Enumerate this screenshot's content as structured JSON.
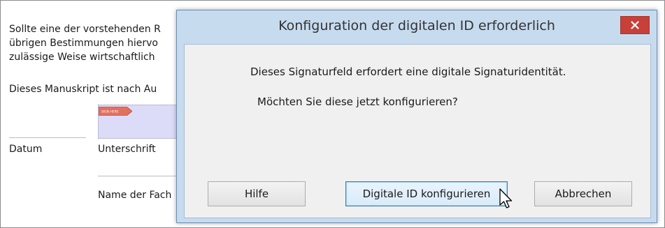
{
  "document": {
    "lines": [
      "Sollte eine der vorstehenden R",
      "übrigen Bestimmungen hiervo",
      "zulässige Weise wirtschaftlich",
      "Dieses Manuskript ist nach Au"
    ],
    "datum_label": "Datum",
    "unterschrift_label": "Unterschrift",
    "name_label": "Name der Fach",
    "signature_arrow_text": "SIGN HERE"
  },
  "dialog": {
    "title": "Konfiguration der digitalen ID erforderlich",
    "message_line1": "Dieses Signaturfeld erfordert eine digitale Signaturidentität.",
    "message_line2": "Möchten Sie diese jetzt konfigurieren?",
    "buttons": {
      "help": "Hilfe",
      "configure": "Digitale ID konfigurieren",
      "cancel": "Abbrechen"
    },
    "close_icon": "close-icon"
  },
  "colors": {
    "dialog_frame": "#c7dbef",
    "close_button": "#c7403a",
    "default_button_border": "#3c7fb1",
    "signature_field": "#dcdcf8"
  }
}
